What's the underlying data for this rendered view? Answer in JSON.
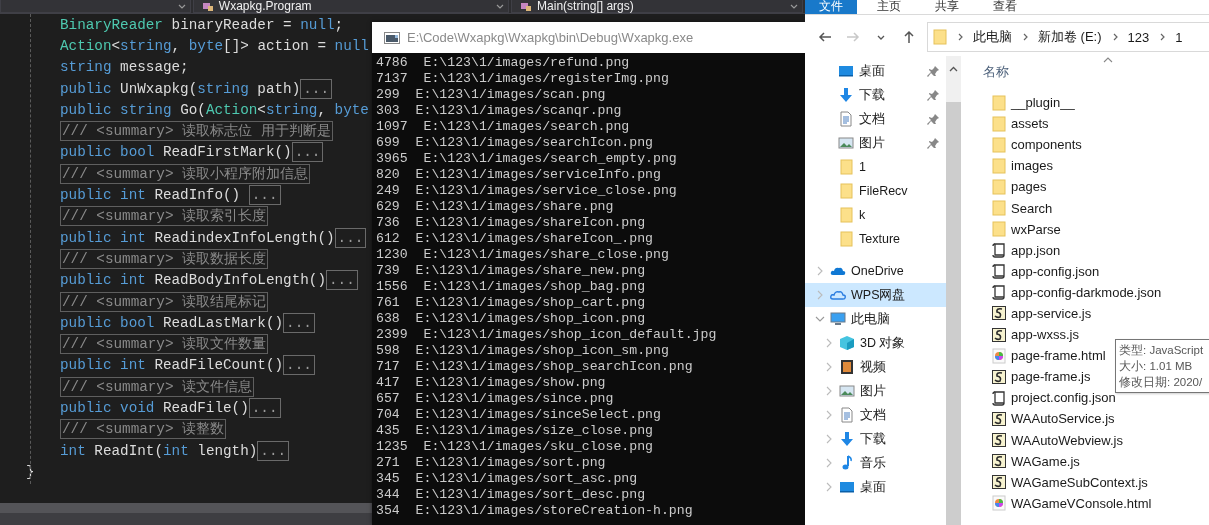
{
  "editor": {
    "dropdowns": [
      {
        "label": "Wxapkg.Program"
      },
      {
        "label": "Main(string[] args)"
      }
    ],
    "lines": [
      {
        "kind": "code",
        "tokens": [
          {
            "kind": "type",
            "text": "BinaryReader"
          },
          {
            "kind": "plain",
            "text": " binaryReader = "
          },
          {
            "kind": "keyword",
            "text": "null"
          },
          {
            "kind": "plain",
            "text": ";"
          }
        ]
      },
      {
        "kind": "code",
        "tokens": [
          {
            "kind": "type",
            "text": "Action"
          },
          {
            "kind": "plain",
            "text": "<"
          },
          {
            "kind": "keyword",
            "text": "string"
          },
          {
            "kind": "plain",
            "text": ", "
          },
          {
            "kind": "keyword",
            "text": "byte"
          },
          {
            "kind": "plain",
            "text": "[]> action = "
          },
          {
            "kind": "keyword",
            "text": "null"
          }
        ]
      },
      {
        "kind": "code",
        "tokens": [
          {
            "kind": "keyword",
            "text": "string"
          },
          {
            "kind": "plain",
            "text": " message;"
          }
        ]
      },
      {
        "kind": "code",
        "tokens": [
          {
            "kind": "keyword",
            "text": "public"
          },
          {
            "kind": "plain",
            "text": " UnWxapkg("
          },
          {
            "kind": "keyword",
            "text": "string"
          },
          {
            "kind": "plain",
            "text": " path)"
          }
        ],
        "collapsed": "..."
      },
      {
        "kind": "code",
        "tokens": [
          {
            "kind": "keyword",
            "text": "public string"
          },
          {
            "kind": "plain",
            "text": " Go("
          },
          {
            "kind": "type",
            "text": "Action"
          },
          {
            "kind": "plain",
            "text": "<"
          },
          {
            "kind": "keyword",
            "text": "string"
          },
          {
            "kind": "plain",
            "text": ", "
          },
          {
            "kind": "keyword",
            "text": "byte"
          }
        ]
      },
      {
        "kind": "comment",
        "text": "/// <summary> 读取标志位 用于判断是"
      },
      {
        "kind": "code",
        "tokens": [
          {
            "kind": "keyword",
            "text": "public bool"
          },
          {
            "kind": "plain",
            "text": " ReadFirstMark()"
          }
        ],
        "collapsed": "..."
      },
      {
        "kind": "comment",
        "text": "/// <summary> 读取小程序附加信息"
      },
      {
        "kind": "code",
        "tokens": [
          {
            "kind": "keyword",
            "text": "public int"
          },
          {
            "kind": "plain",
            "text": " ReadInfo() "
          }
        ],
        "collapsed": "..."
      },
      {
        "kind": "comment",
        "text": "/// <summary> 读取索引长度"
      },
      {
        "kind": "code",
        "tokens": [
          {
            "kind": "keyword",
            "text": "public int"
          },
          {
            "kind": "plain",
            "text": " ReadindexInfoLength()"
          }
        ],
        "collapsed": "..."
      },
      {
        "kind": "comment",
        "text": "/// <summary> 读取数据长度"
      },
      {
        "kind": "code",
        "tokens": [
          {
            "kind": "keyword",
            "text": "public int"
          },
          {
            "kind": "plain",
            "text": " ReadBodyInfoLength()"
          }
        ],
        "collapsed": "..."
      },
      {
        "kind": "comment",
        "text": "/// <summary> 读取结尾标记"
      },
      {
        "kind": "code",
        "tokens": [
          {
            "kind": "keyword",
            "text": "public bool"
          },
          {
            "kind": "plain",
            "text": " ReadLastMark()"
          }
        ],
        "collapsed": "..."
      },
      {
        "kind": "comment",
        "text": "/// <summary> 读取文件数量"
      },
      {
        "kind": "code",
        "tokens": [
          {
            "kind": "keyword",
            "text": "public int"
          },
          {
            "kind": "plain",
            "text": " ReadFileCount()"
          }
        ],
        "collapsed": "..."
      },
      {
        "kind": "comment",
        "text": "/// <summary> 读文件信息"
      },
      {
        "kind": "code",
        "tokens": [
          {
            "kind": "keyword",
            "text": "public void"
          },
          {
            "kind": "plain",
            "text": " ReadFile()"
          }
        ],
        "collapsed": "..."
      },
      {
        "kind": "comment",
        "text": "/// <summary> 读整数"
      },
      {
        "kind": "code",
        "tokens": [
          {
            "kind": "keyword",
            "text": "int"
          },
          {
            "kind": "plain",
            "text": " ReadInt("
          },
          {
            "kind": "keyword",
            "text": "int"
          },
          {
            "kind": "plain",
            "text": " length)"
          }
        ],
        "collapsed": "..."
      }
    ],
    "closing_brace": "}"
  },
  "console": {
    "title": "E:\\Code\\Wxapkg\\Wxapkg\\bin\\Debug\\Wxapkg.exe",
    "lines": [
      "4786  E:\\123\\1/images/refund.png",
      "7137  E:\\123\\1/images/registerImg.png",
      "299  E:\\123\\1/images/scan.png",
      "303  E:\\123\\1/images/scanqr.png",
      "1097  E:\\123\\1/images/search.png",
      "699  E:\\123\\1/images/searchIcon.png",
      "3965  E:\\123\\1/images/search_empty.png",
      "820  E:\\123\\1/images/serviceInfo.png",
      "249  E:\\123\\1/images/service_close.png",
      "629  E:\\123\\1/images/share.png",
      "736  E:\\123\\1/images/shareIcon.png",
      "612  E:\\123\\1/images/shareIcon_.png",
      "1230  E:\\123\\1/images/share_close.png",
      "739  E:\\123\\1/images/share_new.png",
      "1556  E:\\123\\1/images/shop_bag.png",
      "761  E:\\123\\1/images/shop_cart.png",
      "638  E:\\123\\1/images/shop_icon.png",
      "2399  E:\\123\\1/images/shop_icon_default.jpg",
      "598  E:\\123\\1/images/shop_icon_sm.png",
      "717  E:\\123\\1/images/shop_searchIcon.png",
      "417  E:\\123\\1/images/show.png",
      "657  E:\\123\\1/images/since.png",
      "704  E:\\123\\1/images/sinceSelect.png",
      "435  E:\\123\\1/images/size_close.png",
      "1235  E:\\123\\1/images/sku_close.png",
      "271  E:\\123\\1/images/sort.png",
      "345  E:\\123\\1/images/sort_asc.png",
      "344  E:\\123\\1/images/sort_desc.png",
      "354  E:\\123\\1/images/storeCreation-h.png"
    ]
  },
  "explorer": {
    "ribbon_tabs": [
      {
        "label": "文件",
        "selected": true
      },
      {
        "label": "主页",
        "selected": false
      },
      {
        "label": "共享",
        "selected": false
      },
      {
        "label": "查看",
        "selected": false
      }
    ],
    "nav_buttons": [
      {
        "kind": "back",
        "disabled": false
      },
      {
        "kind": "forward",
        "disabled": true
      },
      {
        "kind": "recent",
        "disabled": false
      },
      {
        "kind": "up",
        "disabled": false
      }
    ],
    "breadcrumbs": [
      "此电脑",
      "新加卷 (E:)",
      "123",
      "1"
    ],
    "quick_access": [
      {
        "label": "桌面",
        "kind": "desktop",
        "pinned": true,
        "selected": false
      },
      {
        "label": "下载",
        "kind": "download",
        "pinned": true,
        "selected": false
      },
      {
        "label": "文档",
        "kind": "document",
        "pinned": true,
        "selected": false
      },
      {
        "label": "图片",
        "kind": "picture",
        "pinned": true,
        "selected": false
      },
      {
        "label": "1",
        "kind": "folder",
        "pinned": false,
        "selected": false
      },
      {
        "label": "FileRecv",
        "kind": "folder",
        "pinned": false,
        "selected": false
      },
      {
        "label": "k",
        "kind": "folder",
        "pinned": false,
        "selected": false
      },
      {
        "label": "Texture",
        "kind": "folder",
        "pinned": false,
        "selected": false
      }
    ],
    "tree": [
      {
        "label": "OneDrive",
        "kind": "cloud",
        "expanded": false,
        "selected": false
      },
      {
        "label": "WPS网盘",
        "kind": "outline-cloud",
        "expanded": false,
        "selected": true
      },
      {
        "label": "此电脑",
        "kind": "pc",
        "expanded": true,
        "selected": false,
        "children": [
          {
            "label": "3D 对象",
            "kind": "cube",
            "expanded": false,
            "selected": false
          },
          {
            "label": "视频",
            "kind": "video",
            "expanded": false,
            "selected": false
          },
          {
            "label": "图片",
            "kind": "picture",
            "expanded": false,
            "selected": false
          },
          {
            "label": "文档",
            "kind": "document",
            "expanded": false,
            "selected": false
          },
          {
            "label": "下载",
            "kind": "download",
            "expanded": false,
            "selected": false
          },
          {
            "label": "音乐",
            "kind": "music",
            "expanded": false,
            "selected": false
          },
          {
            "label": "桌面",
            "kind": "desktop",
            "expanded": false,
            "selected": false
          }
        ]
      }
    ],
    "column_header": "名称",
    "files": [
      {
        "name": "__plugin__",
        "kind": "folder"
      },
      {
        "name": "assets",
        "kind": "folder"
      },
      {
        "name": "components",
        "kind": "folder"
      },
      {
        "name": "images",
        "kind": "folder"
      },
      {
        "name": "pages",
        "kind": "folder"
      },
      {
        "name": "Search",
        "kind": "folder"
      },
      {
        "name": "wxParse",
        "kind": "folder"
      },
      {
        "name": "app.json",
        "kind": "json"
      },
      {
        "name": "app-config.json",
        "kind": "json"
      },
      {
        "name": "app-config-darkmode.json",
        "kind": "json"
      },
      {
        "name": "app-service.js",
        "kind": "js"
      },
      {
        "name": "app-wxss.js",
        "kind": "js"
      },
      {
        "name": "page-frame.html",
        "kind": "html"
      },
      {
        "name": "page-frame.js",
        "kind": "js"
      },
      {
        "name": "project.config.json",
        "kind": "json"
      },
      {
        "name": "WAAutoService.js",
        "kind": "js"
      },
      {
        "name": "WAAutoWebview.js",
        "kind": "js"
      },
      {
        "name": "WAGame.js",
        "kind": "js"
      },
      {
        "name": "WAGameSubContext.js",
        "kind": "js"
      },
      {
        "name": "WAGameVConsole.html",
        "kind": "html"
      }
    ],
    "tooltip": [
      "类型: JavaScript",
      "大小: 1.01 MB",
      "修改日期: 2020/"
    ]
  }
}
